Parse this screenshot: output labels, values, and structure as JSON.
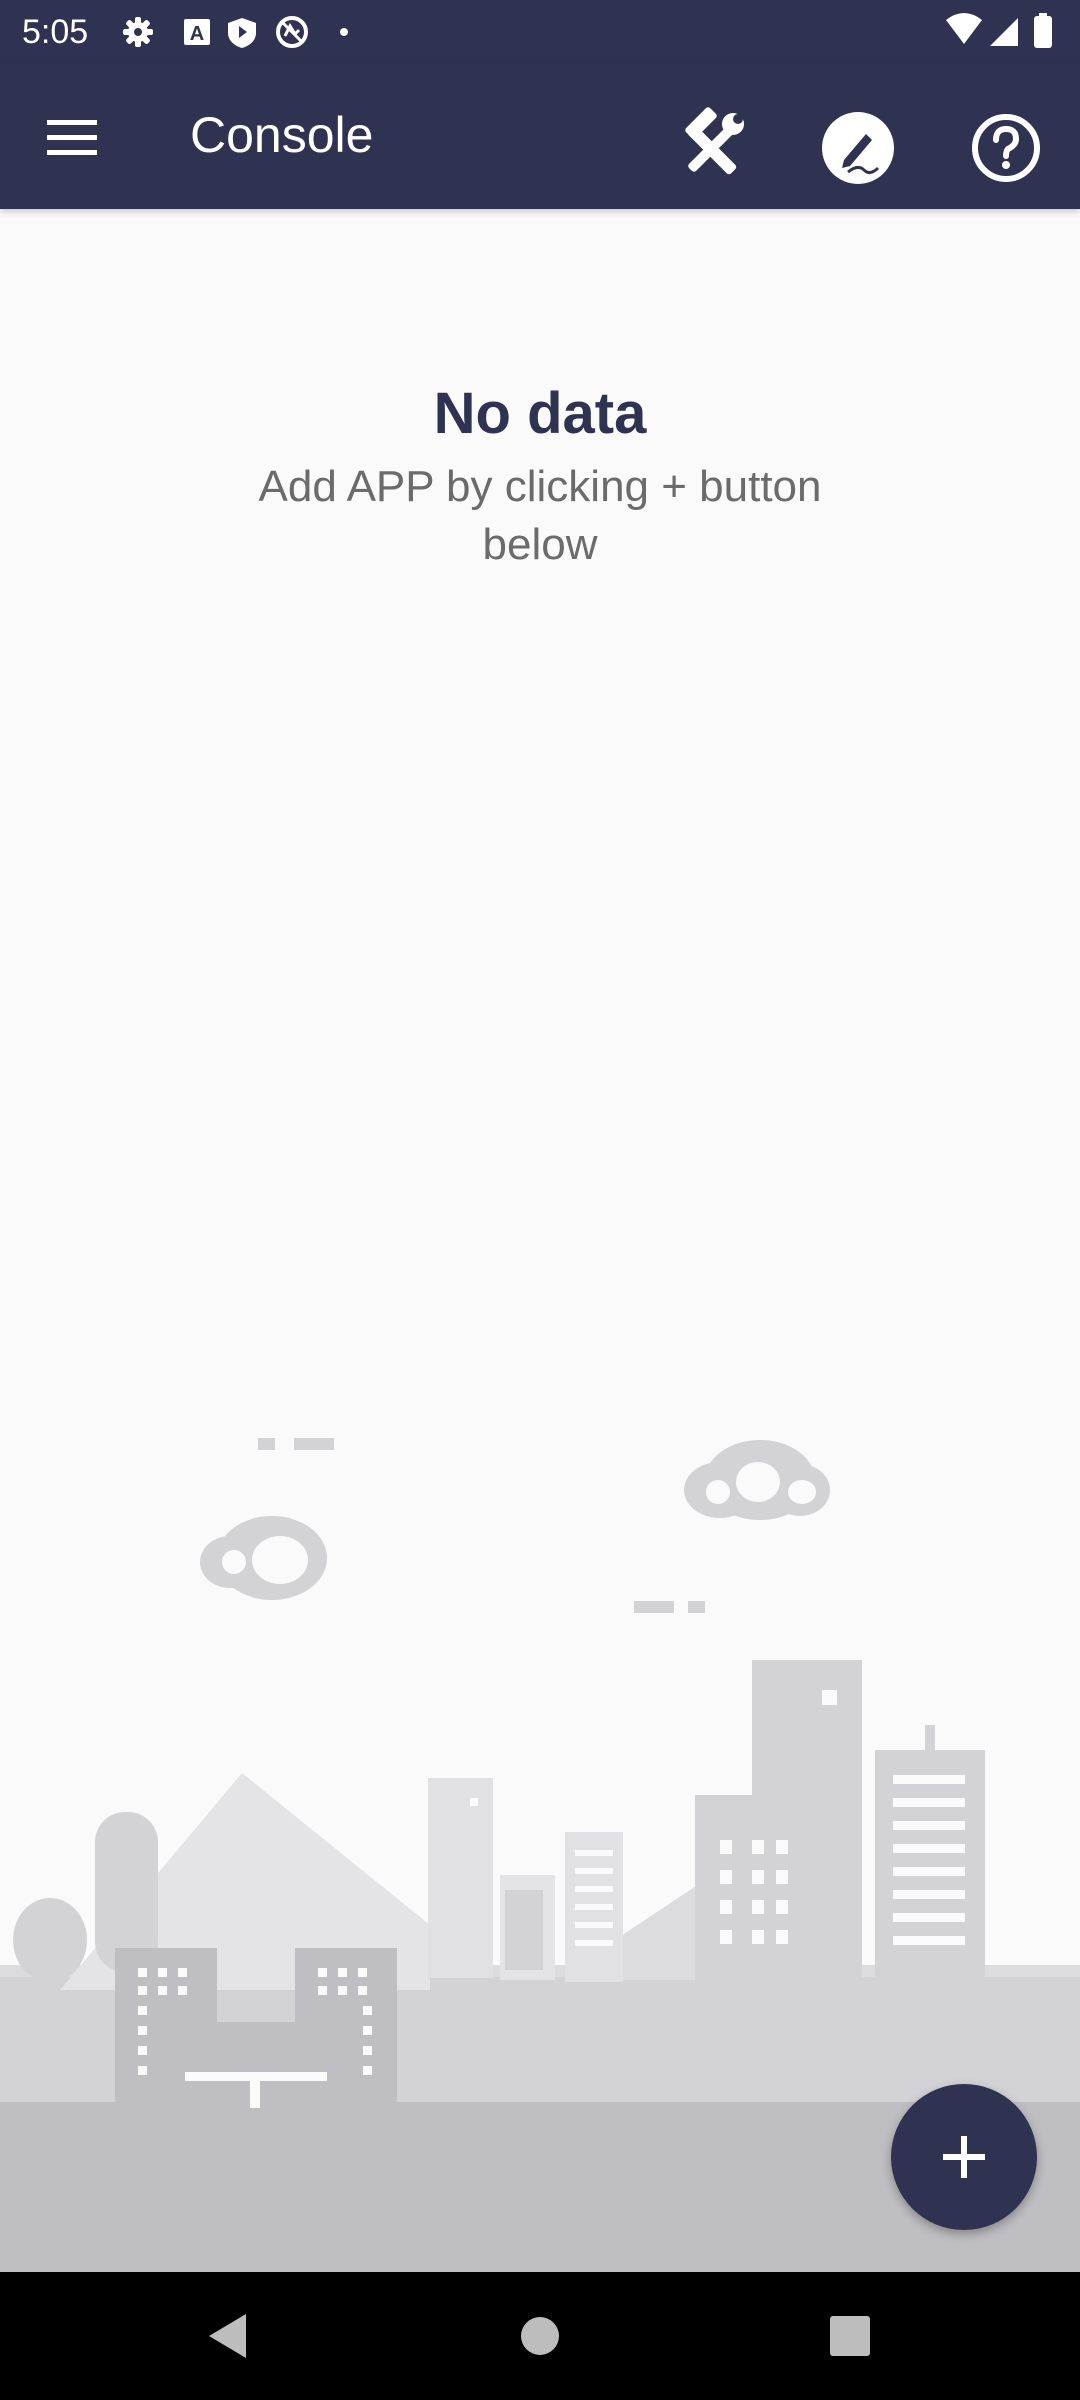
{
  "status_bar": {
    "time": "5:05",
    "left_icons": [
      "settings-icon",
      "text-a-icon",
      "shield-play-icon",
      "vpn-icon",
      "dot-icon"
    ],
    "right_icons": [
      "wifi-icon",
      "signal-icon",
      "battery-icon"
    ]
  },
  "app_bar": {
    "title": "Console",
    "actions": [
      "menu-icon",
      "hammer-wrench-icon",
      "signature-icon",
      "help-icon"
    ]
  },
  "empty_state": {
    "headline": "No data",
    "message": "Add APP by clicking + button below"
  },
  "fab": {
    "label": "+",
    "icon": "plus-icon"
  },
  "nav_bar": {
    "buttons": [
      "back-icon",
      "home-icon",
      "recents-icon"
    ]
  },
  "colors": {
    "primary": "#2f3250",
    "background": "#fafafa",
    "headline": "#2f3250",
    "subtext": "#6b6b6b",
    "illustration": "#d3d3d6"
  }
}
